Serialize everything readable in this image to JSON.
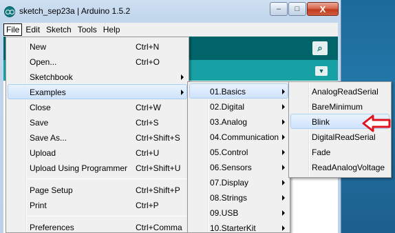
{
  "window": {
    "title": "sketch_sep23a | Arduino 1.5.2",
    "minimize_glyph": "–",
    "maximize_glyph": "□",
    "close_glyph": "X"
  },
  "menubar": [
    "File",
    "Edit",
    "Sketch",
    "Tools",
    "Help"
  ],
  "toolbar": {
    "serial_monitor_glyph": "⌕",
    "tab_menu_glyph": "▼"
  },
  "file_menu": [
    {
      "label": "New",
      "shortcut": "Ctrl+N"
    },
    {
      "label": "Open...",
      "shortcut": "Ctrl+O"
    },
    {
      "label": "Sketchbook",
      "shortcut": ""
    },
    {
      "label": "Examples",
      "shortcut": ""
    },
    {
      "label": "Close",
      "shortcut": "Ctrl+W"
    },
    {
      "label": "Save",
      "shortcut": "Ctrl+S"
    },
    {
      "label": "Save As...",
      "shortcut": "Ctrl+Shift+S"
    },
    {
      "label": "Upload",
      "shortcut": "Ctrl+U"
    },
    {
      "label": "Upload Using Programmer",
      "shortcut": "Ctrl+Shift+U"
    },
    {
      "label": "Page Setup",
      "shortcut": "Ctrl+Shift+P"
    },
    {
      "label": "Print",
      "shortcut": "Ctrl+P"
    },
    {
      "label": "Preferences",
      "shortcut": "Ctrl+Comma"
    }
  ],
  "examples_menu": [
    "01.Basics",
    "02.Digital",
    "03.Analog",
    "04.Communication",
    "05.Control",
    "06.Sensors",
    "07.Display",
    "08.Strings",
    "09.USB",
    "10.StarterKit"
  ],
  "basics_menu": [
    "AnalogReadSerial",
    "BareMinimum",
    "Blink",
    "DigitalReadSerial",
    "Fade",
    "ReadAnalogVoltage"
  ],
  "colors": {
    "toolbar": "#006468",
    "tabs": "#17a1a5",
    "highlight": "#cfe3fb",
    "annotation": "#e0141e"
  }
}
